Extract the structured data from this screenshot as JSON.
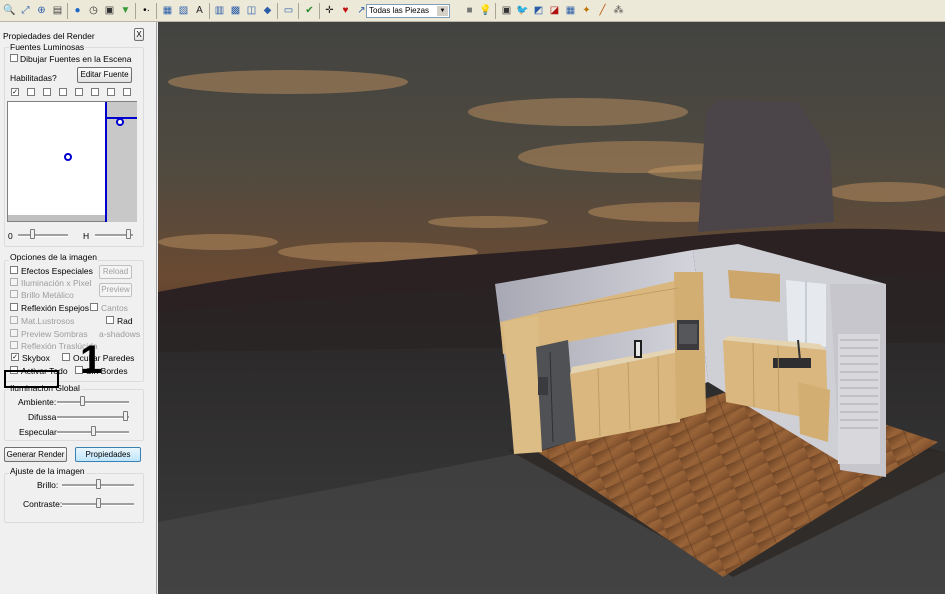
{
  "toolbar": {
    "pieces_select": "Todas las Piezas",
    "icons": [
      "zoom-in-icon",
      "zoom-extents-icon",
      "zoom-window-icon",
      "print-icon",
      "globe-icon",
      "clock-icon",
      "camera-icon",
      "filter-icon",
      "point-icon",
      "grid-icon",
      "layers-icon",
      "text-icon",
      "export-icon",
      "copy-icon",
      "render-icon",
      "cube-icon",
      "window-icon",
      "check-icon",
      "move-icon",
      "paint-icon",
      "wand-icon",
      "square-icon",
      "bulb-icon",
      "photo-icon",
      "twitter-icon",
      "share-icon",
      "gift-icon",
      "screen-icon",
      "magic-icon",
      "group-icon"
    ]
  },
  "panel": {
    "title": "Propiedades del Render",
    "close": "X",
    "lights": {
      "group": "Fuentes Luminosas",
      "draw_lights": "Dibujar Fuentes en la Escena",
      "enabled": "Habilitadas?",
      "edit_button": "Editar Fuente",
      "slider_left": "0",
      "slider_right": "H"
    },
    "image_options": {
      "group": "Opciones de la imagen",
      "special_effects": "Efectos Especiales",
      "pixel_lighting": "Iluminación x Pixel",
      "metallic": "Brillo Metálico",
      "mirror": "Reflexión Espejos",
      "glossy": "Mat.Lustrosos",
      "preview_shadows": "Preview Sombras",
      "shadows_suffix": "a-shadows",
      "translucid": "Reflexión Traslúcida",
      "skybox": "Skybox",
      "activate_all": "Activar Todo",
      "edges": "Cantos",
      "rad": "Rad",
      "hide_walls": "Ocultar Paredes",
      "no_borders": "Sin Bordes",
      "reload": "Reload",
      "preview": "Preview"
    },
    "global_light": {
      "group": "Iluminacion Global",
      "ambient": "Ambiente:",
      "diffuse": "Difussa",
      "specular": "Especular"
    },
    "generate_button": "Generar Render",
    "properties_button": "Propiedades",
    "adjust": {
      "group": "Ajuste de la imagen",
      "brightness": "Brillo:",
      "contrast": "Contraste:"
    }
  },
  "annotation": {
    "number": "1"
  },
  "colors": {
    "sky_top": "#3d3e3c",
    "sunset": "#c98a4a",
    "floor_wood": "#8a5a32",
    "cabinet": "#d9b77e",
    "accent_blue": "#0000cc"
  }
}
